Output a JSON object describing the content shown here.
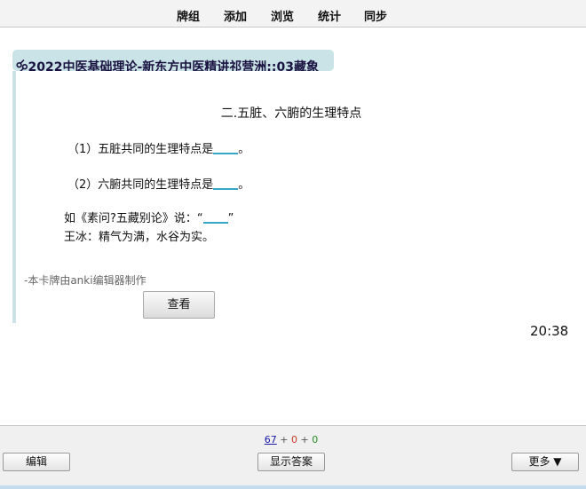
{
  "menu": {
    "decks": "牌组",
    "add": "添加",
    "browse": "浏览",
    "stats": "统计",
    "sync": "同步"
  },
  "card": {
    "deck_title": "🝰2022中医基础理论-新东方中医精讲祁营洲::03藏象",
    "section_title": "二.五脏、六腑的生理特点",
    "line1_text": "（1）五脏共同的生理特点是",
    "line2_text": "（2）六腑共同的生理特点是",
    "line_end": "。",
    "quote_open": "如《素问?五藏别论》说：“",
    "quote_close": "”",
    "quote_line2": "王冰：精气为满，水谷为实。",
    "credit": "-本卡牌由anki编辑器制作",
    "check_button": "查看"
  },
  "timer": "20:38",
  "bottom": {
    "count_new": "67",
    "count_learn": "0",
    "count_review": "0",
    "separator": "+",
    "edit_button": "编辑",
    "show_answer_button": "显示答案",
    "more_button": "更多 ▼"
  },
  "colors": {
    "accent": "#35a6c5",
    "deck_bar": "#c9e3e6",
    "new_count": "#1a1aa6",
    "learn_count": "#c83a2a",
    "review_count": "#2a8a2a"
  }
}
